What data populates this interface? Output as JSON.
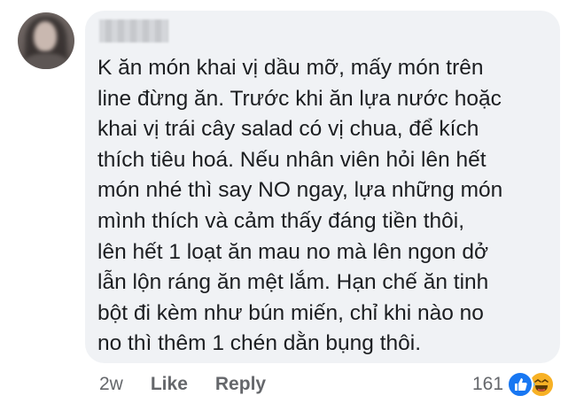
{
  "comment": {
    "author_redacted": true,
    "text": "K ăn món khai vị dầu mỡ, mấy món trên\nline đừng ăn. Trước khi ăn lựa nước hoặc\nkhai vị trái cây salad có vị chua, để kích\nthích tiêu hoá. Nếu nhân viên hỏi lên hết\nmón nhé thì say NO ngay, lựa những món\nmình thích và cảm thấy đáng tiền thôi,\nlên hết 1 loạt ăn mau no mà lên ngon dở\nlẫn lộn ráng ăn mệt lắm. Hạn chế ăn tinh\nbột đi kèm như bún miến, chỉ khi nào no\nno thì thêm 1 chén dằn bụng thôi."
  },
  "actions": {
    "time": "2w",
    "like_label": "Like",
    "reply_label": "Reply"
  },
  "reactions": {
    "count": "161",
    "types": [
      "like-icon",
      "haha-icon"
    ],
    "colors": {
      "like": "#1877f2",
      "haha": "#f7b125"
    }
  }
}
